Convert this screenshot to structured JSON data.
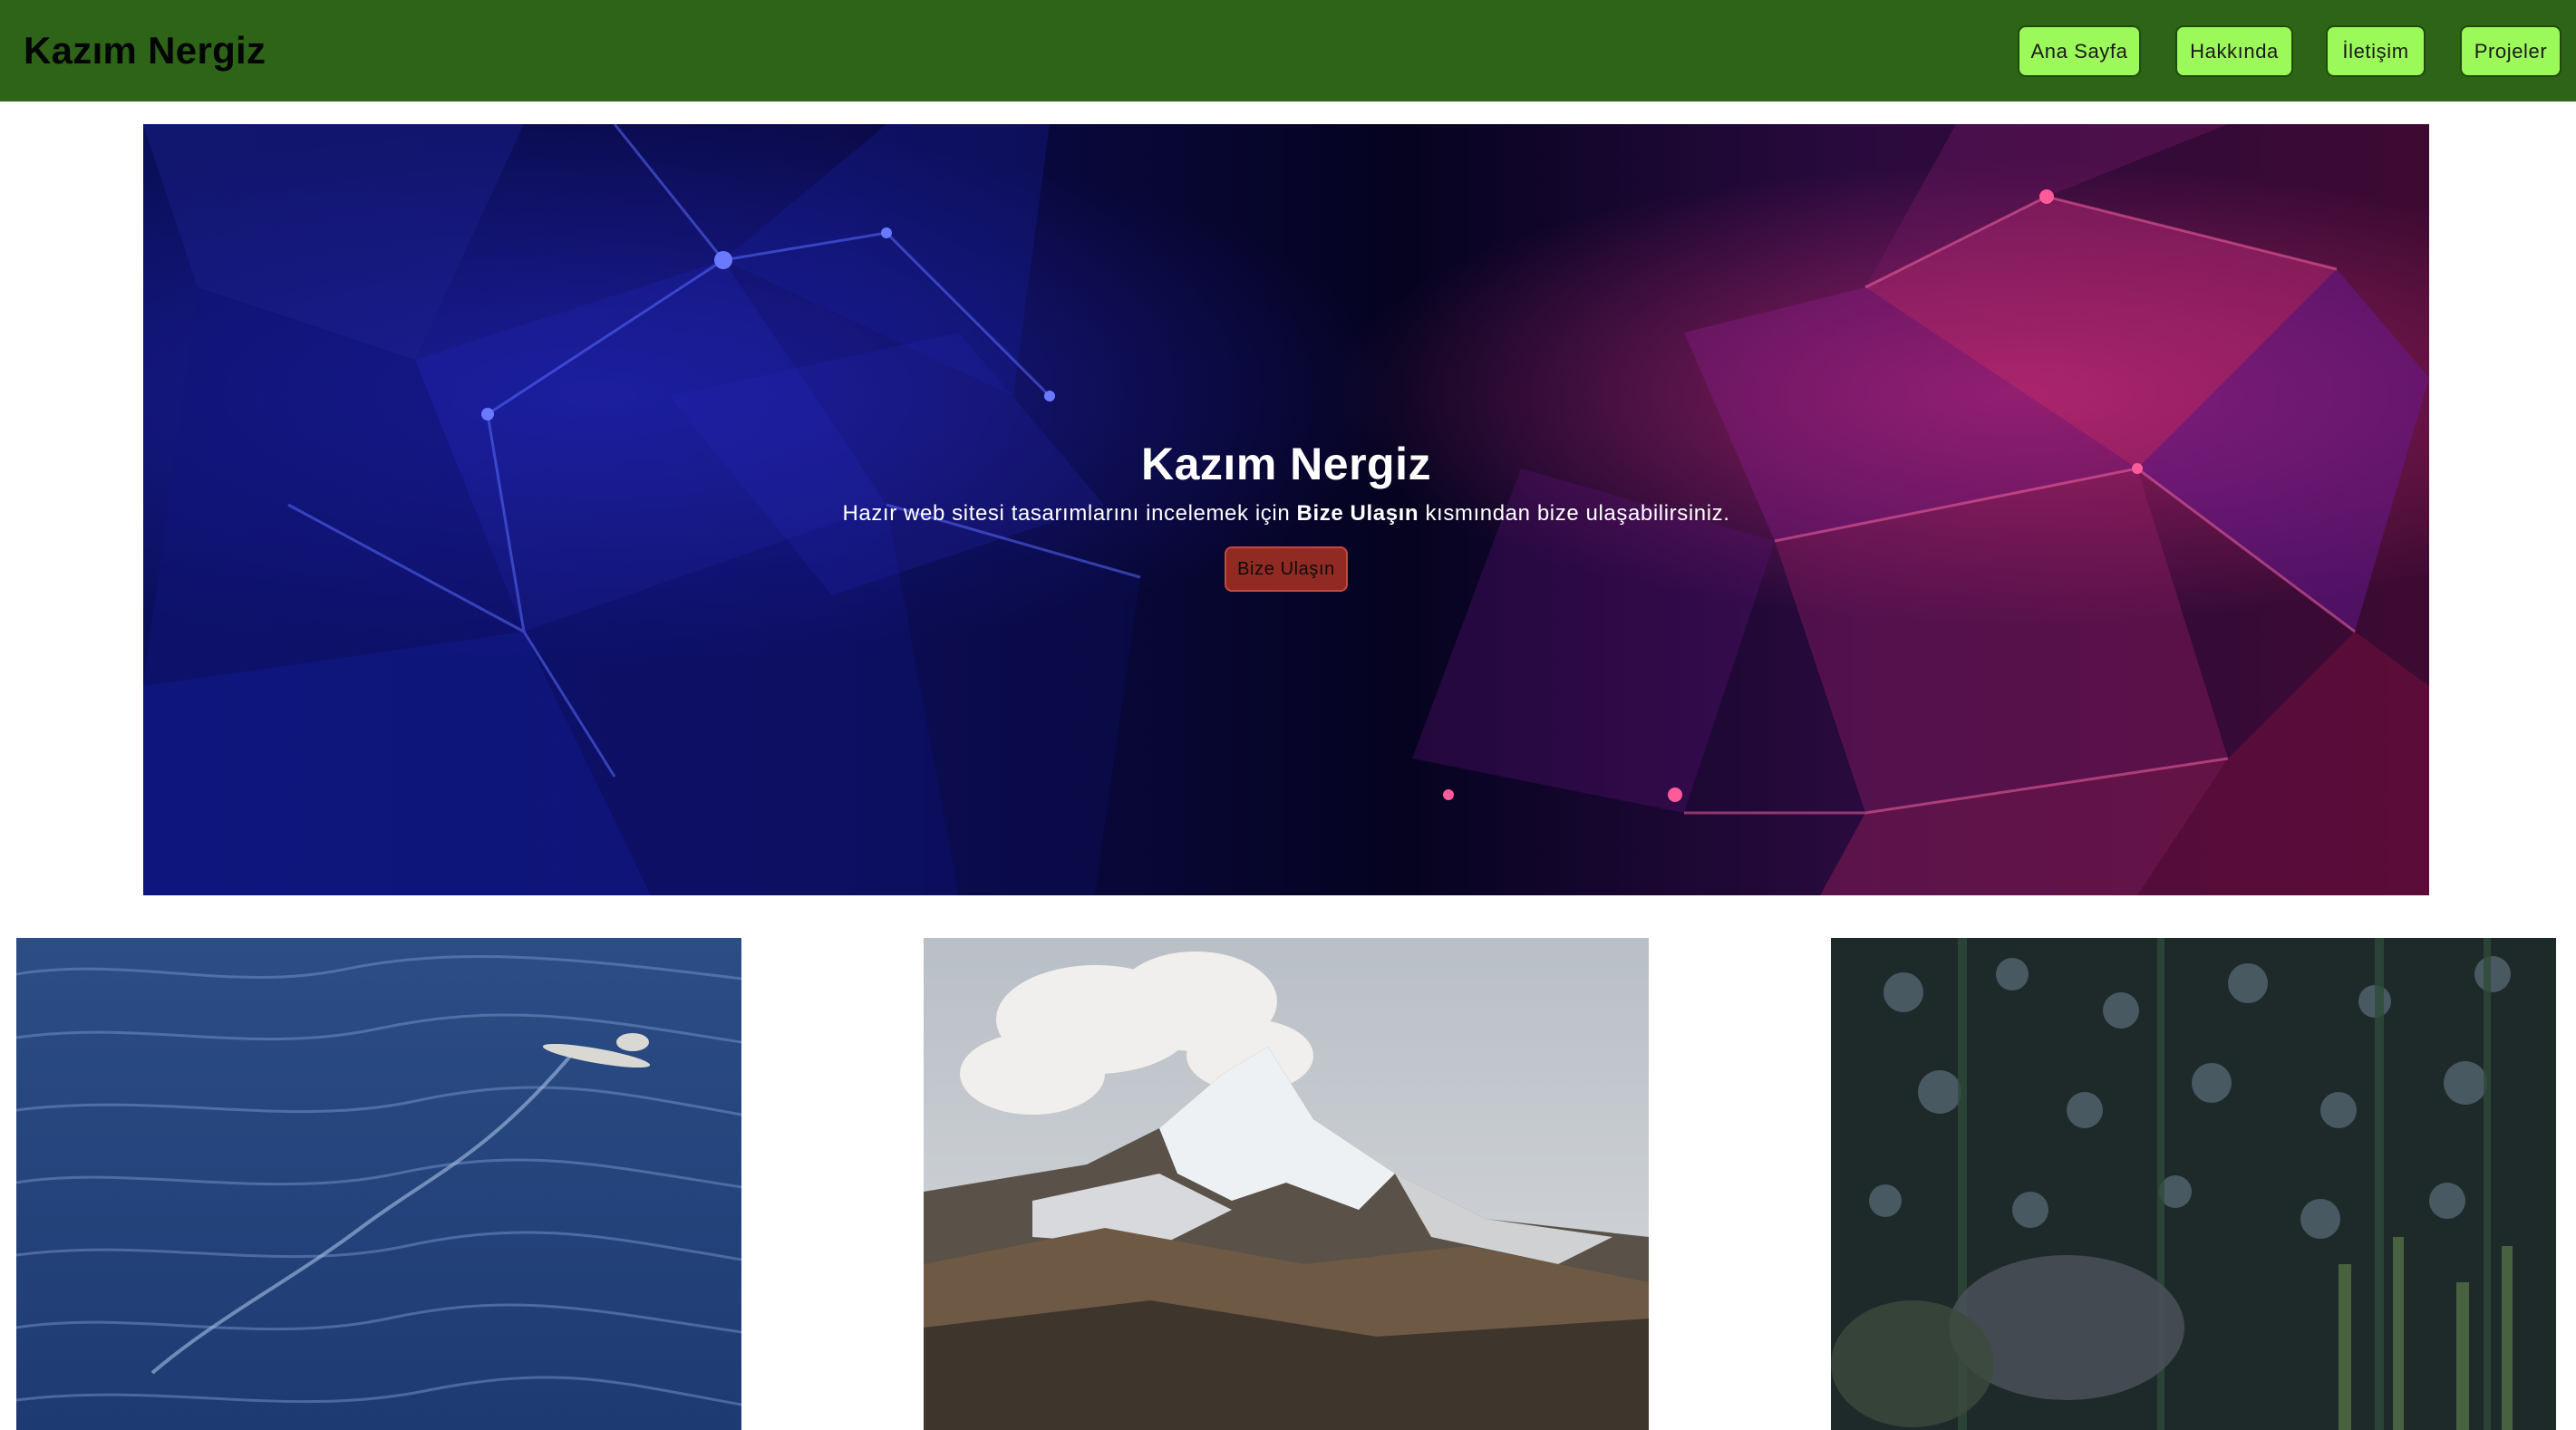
{
  "navbar": {
    "brand": "Kazım Nergiz",
    "links": [
      "Ana Sayfa",
      "Hakkında",
      "İletişim",
      "Projeler"
    ],
    "background_color": "#2d6418",
    "button_color": "#9bf95a"
  },
  "hero": {
    "title": "Kazım Nergiz",
    "subtitle_before": "Hazır web sitesi tasarımlarını incelemek için ",
    "subtitle_bold": "Bize Ulaşın",
    "subtitle_after": " kısmından bize ulaşabilirsiniz.",
    "button_label": "Bize Ulaşın",
    "button_color": "#922a24",
    "background_image": "low-poly-network-blue-magenta"
  },
  "gallery": {
    "images": [
      {
        "subject": "seabird-over-ocean-waves"
      },
      {
        "subject": "snowy-mountain-peak-with-clouds"
      },
      {
        "subject": "forest-treetops-with-snow"
      }
    ]
  }
}
